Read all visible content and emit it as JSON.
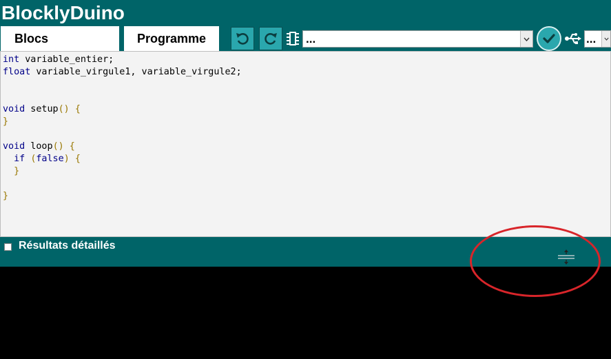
{
  "app": {
    "title": "BlocklyDuino"
  },
  "tabs": [
    {
      "label": "Blocs",
      "active": true
    },
    {
      "label": "Programme",
      "active": false
    }
  ],
  "toolbar": {
    "undo_icon": "undo-icon",
    "redo_icon": "redo-icon",
    "board_icon": "chip-icon",
    "board_select": {
      "value": "..."
    },
    "verify_icon": "check-icon",
    "usb_icon": "usb-icon",
    "port_select": {
      "value": "..."
    }
  },
  "code": {
    "lines": [
      "int variable_entier;",
      "float variable_virgule1, variable_virgule2;",
      "",
      "",
      "void setup() {",
      "}",
      "",
      "void loop() {",
      "  if (false) {",
      "  }",
      "",
      "}"
    ]
  },
  "results": {
    "label": "Résultats détaillés",
    "checked": false
  },
  "colors": {
    "header": "#006468",
    "button": "#2aa7ad",
    "code_bg": "#f3f3f3",
    "console_bg": "#000000",
    "annotation": "#d8252a"
  }
}
